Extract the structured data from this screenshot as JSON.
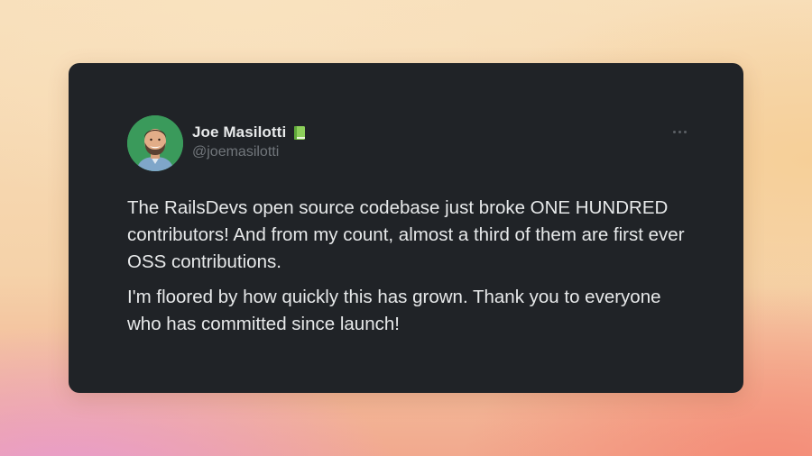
{
  "author": {
    "name": "Joe Masilotti",
    "handle": "@joemasilotti",
    "badge_icon": "green-book-icon"
  },
  "tweet": {
    "paragraphs": [
      "The RailsDevs open source codebase just broke ONE HUNDRED contributors! And from my count, almost a third of them are first ever OSS contributions.",
      "I'm floored by how quickly this has grown. Thank you to everyone who has committed since launch!"
    ]
  },
  "menu": {
    "icon": "more-options-icon"
  },
  "colors": {
    "card_background": "#202327",
    "text_primary": "#e7e9ea",
    "text_secondary": "#71767b",
    "avatar_background": "#3a9a5b"
  }
}
